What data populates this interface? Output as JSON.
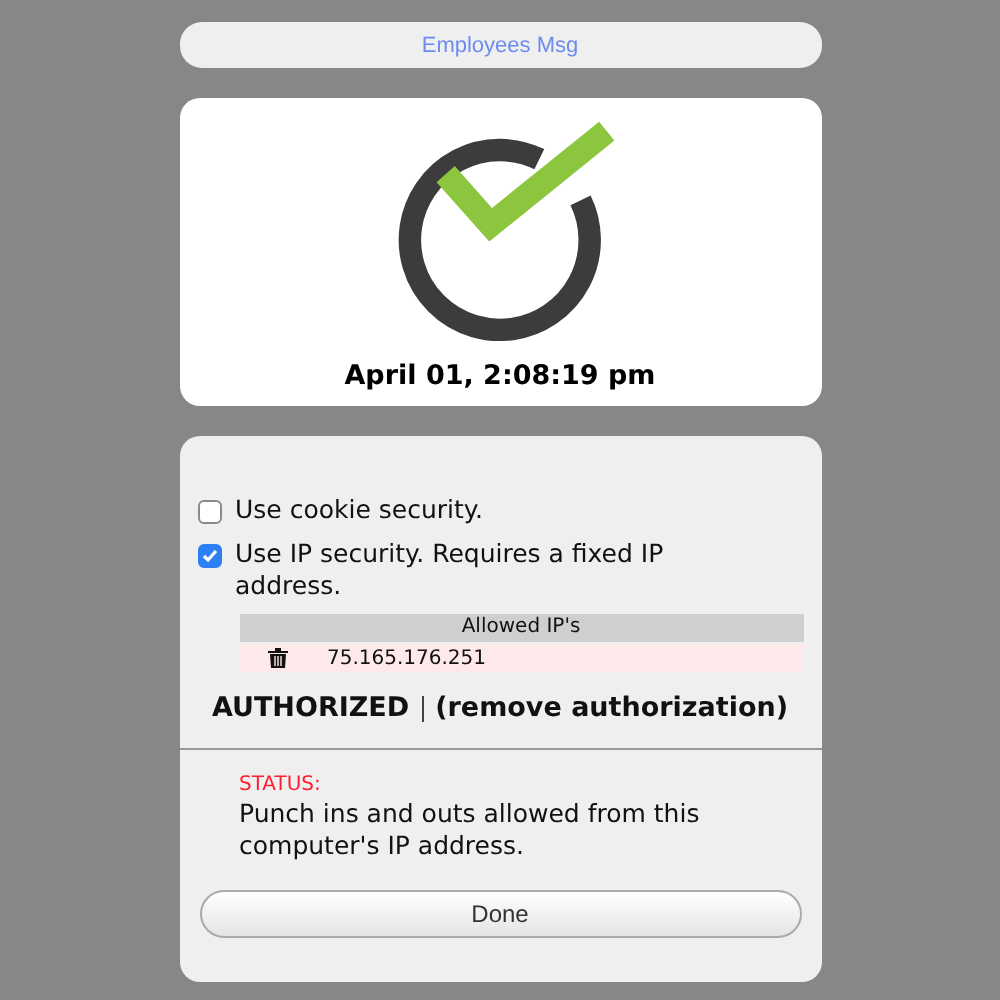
{
  "header_button": {
    "label": "Employees Msg"
  },
  "clock": {
    "time": "April 01, 2:08:19 pm"
  },
  "options": [
    {
      "label": "Use cookie security.",
      "checked": false
    },
    {
      "label": "Use IP security. Requires a fixed IP address.",
      "checked": true
    }
  ],
  "allowed_ips": {
    "heading": "Allowed IP's",
    "rows": [
      {
        "ip": "75.165.176.251"
      }
    ]
  },
  "authorization": {
    "state": "AUTHORIZED",
    "link": "(remove authorization)"
  },
  "status": {
    "label": "STATUS:",
    "message": "Punch ins and outs allowed from this computer's IP address."
  },
  "done_button": {
    "label": "Done"
  }
}
